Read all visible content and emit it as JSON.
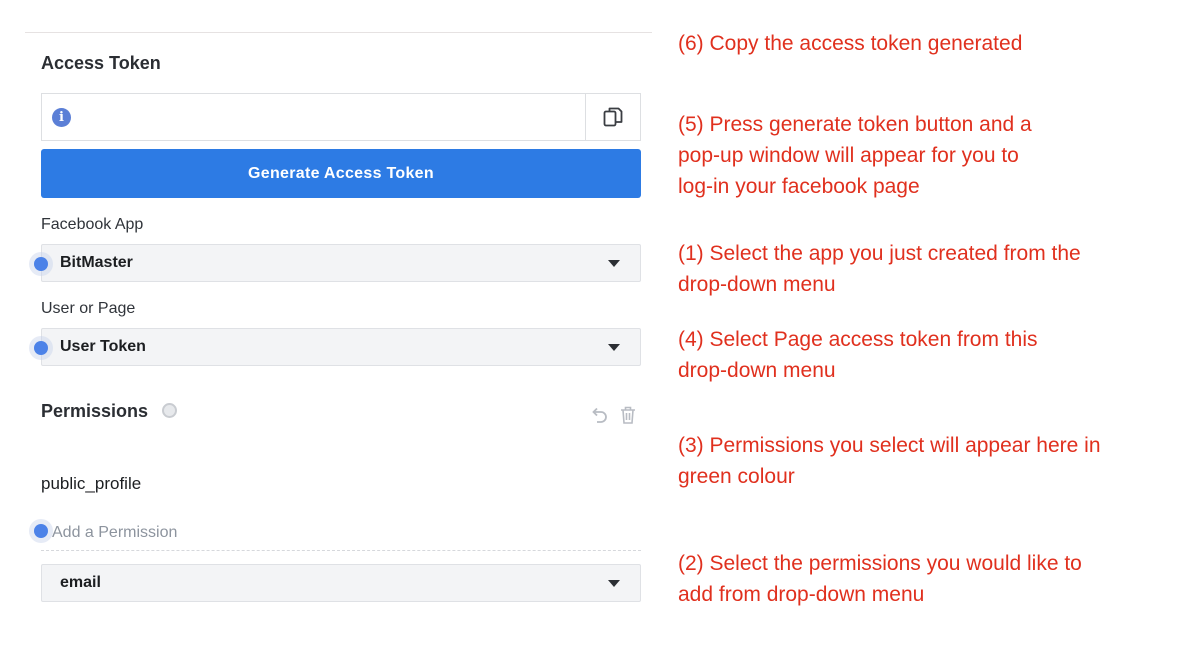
{
  "panel": {
    "access_token": {
      "title": "Access Token",
      "value": "",
      "info_icon": "info-icon",
      "copy_icon": "copy-icon",
      "generate_label": "Generate Access Token"
    },
    "facebook_app": {
      "label": "Facebook App",
      "value": "BitMaster"
    },
    "user_or_page": {
      "label": "User or Page",
      "value": "User Token"
    },
    "permissions": {
      "title": "Permissions",
      "items": [
        "public_profile"
      ],
      "add_placeholder": "Add a Permission",
      "select_value": "email"
    }
  },
  "annotations": [
    {
      "lines": [
        "(6) Copy the access token generated"
      ]
    },
    {
      "lines": [
        "(5) Press generate token button and a",
        "pop-up window will appear for you to",
        "log-in your facebook page"
      ]
    },
    {
      "lines": [
        "(1) Select the app you just created from the",
        "drop-down menu"
      ]
    },
    {
      "lines": [
        "(4) Select Page access token from this",
        "drop-down menu"
      ]
    },
    {
      "lines": [
        "(3) Permissions you select will appear here in",
        "green colour"
      ]
    },
    {
      "lines": [
        "(2) Select the permissions you would like to",
        "add from drop-down menu"
      ]
    }
  ],
  "colors": {
    "primary_button": "#2d7be4",
    "annotation_text": "#e0301e",
    "cursor_dot": "#4c82e8"
  }
}
